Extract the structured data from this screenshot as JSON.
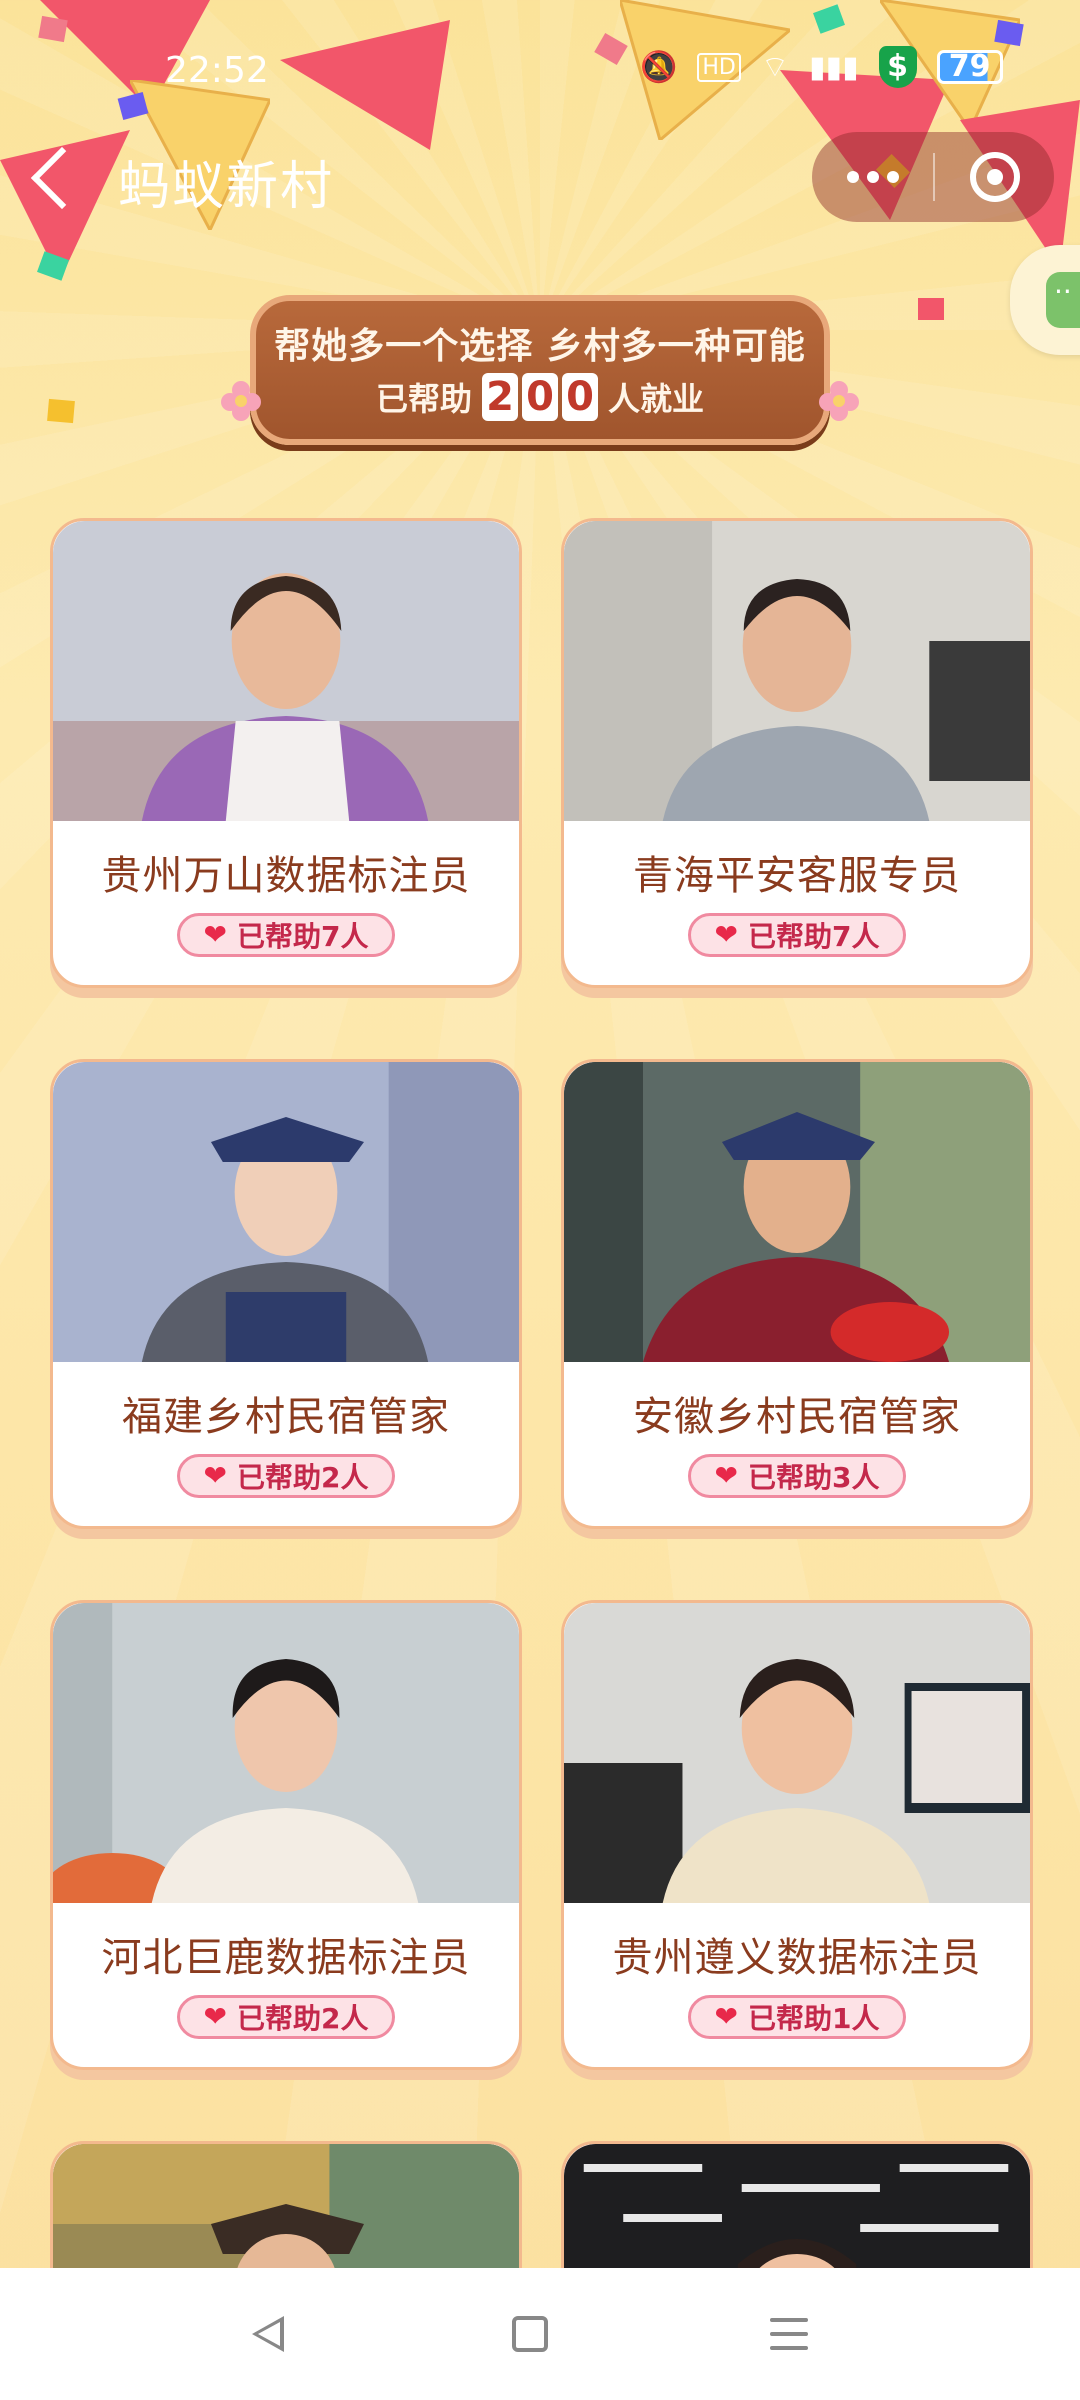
{
  "status_bar": {
    "time": "22:52",
    "battery_level": "79",
    "icons": [
      "mute-icon",
      "hd-icon",
      "wifi-icon",
      "signal-icon",
      "shield-icon",
      "battery-icon"
    ]
  },
  "nav": {
    "back_icon": "back-chevron-icon",
    "title": "蚂蚁新村",
    "more_icon": "more-dots-icon",
    "close_icon": "target-close-icon"
  },
  "banner": {
    "line1": "帮她多一个选择 乡村多一种可能",
    "prefix": "已帮助",
    "digits": [
      "2",
      "0",
      "0"
    ],
    "suffix": "人就业"
  },
  "cards": [
    {
      "title": "贵州万山数据标注员",
      "badge": "已帮助7人"
    },
    {
      "title": "青海平安客服专员",
      "badge": "已帮助7人"
    },
    {
      "title": "福建乡村民宿管家",
      "badge": "已帮助2人"
    },
    {
      "title": "安徽乡村民宿管家",
      "badge": "已帮助3人"
    },
    {
      "title": "河北巨鹿数据标注员",
      "badge": "已帮助2人"
    },
    {
      "title": "贵州遵义数据标注员",
      "badge": "已帮助1人"
    }
  ],
  "colors": {
    "background": "#fde6a8",
    "banner": "#a0552d",
    "card_title": "#8a3b1e",
    "badge_text": "#c4284b",
    "badge_bg": "#fde2e6"
  },
  "system_nav": {
    "icons": [
      "system-back-icon",
      "system-home-icon",
      "system-menu-icon"
    ]
  }
}
